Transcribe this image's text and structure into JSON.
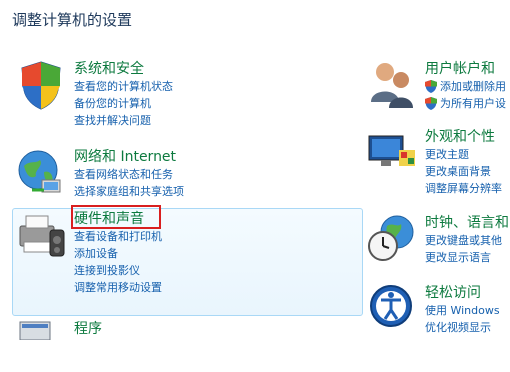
{
  "page_title": "调整计算机的设置",
  "left": [
    {
      "id": "security",
      "title": "系统和安全",
      "links": [
        "查看您的计算机状态",
        "备份您的计算机",
        "查找并解决问题"
      ],
      "icon": "shield-flag-icon"
    },
    {
      "id": "network",
      "title": "网络和 Internet",
      "links": [
        "查看网络状态和任务",
        "选择家庭组和共享选项"
      ],
      "icon": "globe-network-icon"
    },
    {
      "id": "hardware",
      "title": "硬件和声音",
      "links": [
        "查看设备和打印机",
        "添加设备",
        "连接到投影仪",
        "调整常用移动设置"
      ],
      "icon": "printer-speaker-icon"
    },
    {
      "id": "programs",
      "title": "程序",
      "links": [],
      "icon": "programs-icon"
    }
  ],
  "right": [
    {
      "id": "accounts",
      "title": "用户帐户和",
      "links": [
        "添加或删除用",
        "为所有用户设"
      ],
      "icon": "users-icon"
    },
    {
      "id": "appearance",
      "title": "外观和个性",
      "links": [
        "更改主题",
        "更改桌面背景",
        "调整屏幕分辨率"
      ],
      "icon": "monitor-palette-icon"
    },
    {
      "id": "clock",
      "title": "时钟、语言和",
      "links": [
        "更改键盘或其他",
        "更改显示语言"
      ],
      "icon": "clock-globe-icon"
    },
    {
      "id": "ease",
      "title": "轻松访问",
      "links": [
        "使用 Windows",
        "优化视频显示"
      ],
      "icon": "ease-of-access-icon"
    }
  ],
  "colors": {
    "title_green": "#0d7a3f",
    "link_blue": "#1660ad",
    "highlight_red": "#d91f1f"
  }
}
